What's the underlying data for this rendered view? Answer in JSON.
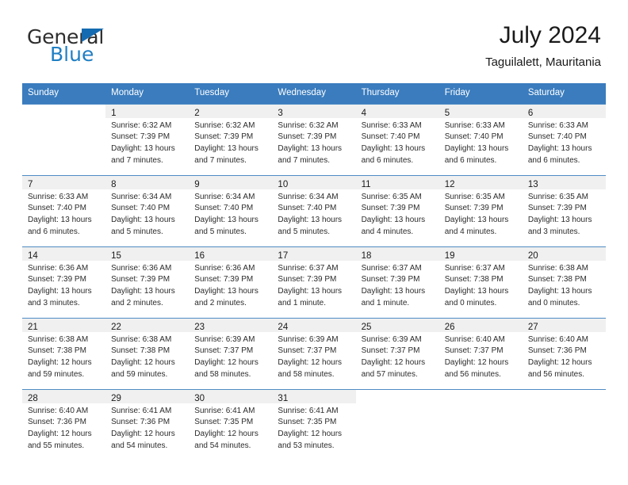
{
  "brand": {
    "word_one": "General",
    "word_two": "Blue",
    "triangle_color": "#156bb1",
    "blue_text_color": "#1f7fc4"
  },
  "header": {
    "title": "July 2024",
    "subtitle": "Taguilalett, Mauritania"
  },
  "theme": {
    "header_row_background": "#3a7cbe",
    "header_row_text": "#ffffff",
    "row_divider": "#4f8cc4",
    "daynum_band_shaded": "#f0f0f0",
    "page_background": "#ffffff"
  },
  "weekdays": [
    "Sunday",
    "Monday",
    "Tuesday",
    "Wednesday",
    "Thursday",
    "Friday",
    "Saturday"
  ],
  "weeks": [
    [
      {
        "day": "",
        "sunrise": "",
        "sunset": "",
        "daylight_line1": "",
        "daylight_line2": "",
        "empty": true
      },
      {
        "day": "1",
        "sunrise": "Sunrise: 6:32 AM",
        "sunset": "Sunset: 7:39 PM",
        "daylight_line1": "Daylight: 13 hours",
        "daylight_line2": "and 7 minutes."
      },
      {
        "day": "2",
        "sunrise": "Sunrise: 6:32 AM",
        "sunset": "Sunset: 7:39 PM",
        "daylight_line1": "Daylight: 13 hours",
        "daylight_line2": "and 7 minutes."
      },
      {
        "day": "3",
        "sunrise": "Sunrise: 6:32 AM",
        "sunset": "Sunset: 7:39 PM",
        "daylight_line1": "Daylight: 13 hours",
        "daylight_line2": "and 7 minutes."
      },
      {
        "day": "4",
        "sunrise": "Sunrise: 6:33 AM",
        "sunset": "Sunset: 7:40 PM",
        "daylight_line1": "Daylight: 13 hours",
        "daylight_line2": "and 6 minutes."
      },
      {
        "day": "5",
        "sunrise": "Sunrise: 6:33 AM",
        "sunset": "Sunset: 7:40 PM",
        "daylight_line1": "Daylight: 13 hours",
        "daylight_line2": "and 6 minutes."
      },
      {
        "day": "6",
        "sunrise": "Sunrise: 6:33 AM",
        "sunset": "Sunset: 7:40 PM",
        "daylight_line1": "Daylight: 13 hours",
        "daylight_line2": "and 6 minutes."
      }
    ],
    [
      {
        "day": "7",
        "sunrise": "Sunrise: 6:33 AM",
        "sunset": "Sunset: 7:40 PM",
        "daylight_line1": "Daylight: 13 hours",
        "daylight_line2": "and 6 minutes."
      },
      {
        "day": "8",
        "sunrise": "Sunrise: 6:34 AM",
        "sunset": "Sunset: 7:40 PM",
        "daylight_line1": "Daylight: 13 hours",
        "daylight_line2": "and 5 minutes."
      },
      {
        "day": "9",
        "sunrise": "Sunrise: 6:34 AM",
        "sunset": "Sunset: 7:40 PM",
        "daylight_line1": "Daylight: 13 hours",
        "daylight_line2": "and 5 minutes."
      },
      {
        "day": "10",
        "sunrise": "Sunrise: 6:34 AM",
        "sunset": "Sunset: 7:40 PM",
        "daylight_line1": "Daylight: 13 hours",
        "daylight_line2": "and 5 minutes."
      },
      {
        "day": "11",
        "sunrise": "Sunrise: 6:35 AM",
        "sunset": "Sunset: 7:39 PM",
        "daylight_line1": "Daylight: 13 hours",
        "daylight_line2": "and 4 minutes."
      },
      {
        "day": "12",
        "sunrise": "Sunrise: 6:35 AM",
        "sunset": "Sunset: 7:39 PM",
        "daylight_line1": "Daylight: 13 hours",
        "daylight_line2": "and 4 minutes."
      },
      {
        "day": "13",
        "sunrise": "Sunrise: 6:35 AM",
        "sunset": "Sunset: 7:39 PM",
        "daylight_line1": "Daylight: 13 hours",
        "daylight_line2": "and 3 minutes."
      }
    ],
    [
      {
        "day": "14",
        "sunrise": "Sunrise: 6:36 AM",
        "sunset": "Sunset: 7:39 PM",
        "daylight_line1": "Daylight: 13 hours",
        "daylight_line2": "and 3 minutes."
      },
      {
        "day": "15",
        "sunrise": "Sunrise: 6:36 AM",
        "sunset": "Sunset: 7:39 PM",
        "daylight_line1": "Daylight: 13 hours",
        "daylight_line2": "and 2 minutes."
      },
      {
        "day": "16",
        "sunrise": "Sunrise: 6:36 AM",
        "sunset": "Sunset: 7:39 PM",
        "daylight_line1": "Daylight: 13 hours",
        "daylight_line2": "and 2 minutes."
      },
      {
        "day": "17",
        "sunrise": "Sunrise: 6:37 AM",
        "sunset": "Sunset: 7:39 PM",
        "daylight_line1": "Daylight: 13 hours",
        "daylight_line2": "and 1 minute."
      },
      {
        "day": "18",
        "sunrise": "Sunrise: 6:37 AM",
        "sunset": "Sunset: 7:39 PM",
        "daylight_line1": "Daylight: 13 hours",
        "daylight_line2": "and 1 minute."
      },
      {
        "day": "19",
        "sunrise": "Sunrise: 6:37 AM",
        "sunset": "Sunset: 7:38 PM",
        "daylight_line1": "Daylight: 13 hours",
        "daylight_line2": "and 0 minutes."
      },
      {
        "day": "20",
        "sunrise": "Sunrise: 6:38 AM",
        "sunset": "Sunset: 7:38 PM",
        "daylight_line1": "Daylight: 13 hours",
        "daylight_line2": "and 0 minutes."
      }
    ],
    [
      {
        "day": "21",
        "sunrise": "Sunrise: 6:38 AM",
        "sunset": "Sunset: 7:38 PM",
        "daylight_line1": "Daylight: 12 hours",
        "daylight_line2": "and 59 minutes."
      },
      {
        "day": "22",
        "sunrise": "Sunrise: 6:38 AM",
        "sunset": "Sunset: 7:38 PM",
        "daylight_line1": "Daylight: 12 hours",
        "daylight_line2": "and 59 minutes."
      },
      {
        "day": "23",
        "sunrise": "Sunrise: 6:39 AM",
        "sunset": "Sunset: 7:37 PM",
        "daylight_line1": "Daylight: 12 hours",
        "daylight_line2": "and 58 minutes."
      },
      {
        "day": "24",
        "sunrise": "Sunrise: 6:39 AM",
        "sunset": "Sunset: 7:37 PM",
        "daylight_line1": "Daylight: 12 hours",
        "daylight_line2": "and 58 minutes."
      },
      {
        "day": "25",
        "sunrise": "Sunrise: 6:39 AM",
        "sunset": "Sunset: 7:37 PM",
        "daylight_line1": "Daylight: 12 hours",
        "daylight_line2": "and 57 minutes."
      },
      {
        "day": "26",
        "sunrise": "Sunrise: 6:40 AM",
        "sunset": "Sunset: 7:37 PM",
        "daylight_line1": "Daylight: 12 hours",
        "daylight_line2": "and 56 minutes."
      },
      {
        "day": "27",
        "sunrise": "Sunrise: 6:40 AM",
        "sunset": "Sunset: 7:36 PM",
        "daylight_line1": "Daylight: 12 hours",
        "daylight_line2": "and 56 minutes."
      }
    ],
    [
      {
        "day": "28",
        "sunrise": "Sunrise: 6:40 AM",
        "sunset": "Sunset: 7:36 PM",
        "daylight_line1": "Daylight: 12 hours",
        "daylight_line2": "and 55 minutes."
      },
      {
        "day": "29",
        "sunrise": "Sunrise: 6:41 AM",
        "sunset": "Sunset: 7:36 PM",
        "daylight_line1": "Daylight: 12 hours",
        "daylight_line2": "and 54 minutes."
      },
      {
        "day": "30",
        "sunrise": "Sunrise: 6:41 AM",
        "sunset": "Sunset: 7:35 PM",
        "daylight_line1": "Daylight: 12 hours",
        "daylight_line2": "and 54 minutes."
      },
      {
        "day": "31",
        "sunrise": "Sunrise: 6:41 AM",
        "sunset": "Sunset: 7:35 PM",
        "daylight_line1": "Daylight: 12 hours",
        "daylight_line2": "and 53 minutes."
      },
      {
        "day": "",
        "sunrise": "",
        "sunset": "",
        "daylight_line1": "",
        "daylight_line2": "",
        "empty": true
      },
      {
        "day": "",
        "sunrise": "",
        "sunset": "",
        "daylight_line1": "",
        "daylight_line2": "",
        "empty": true
      },
      {
        "day": "",
        "sunrise": "",
        "sunset": "",
        "daylight_line1": "",
        "daylight_line2": "",
        "empty": true
      }
    ]
  ]
}
